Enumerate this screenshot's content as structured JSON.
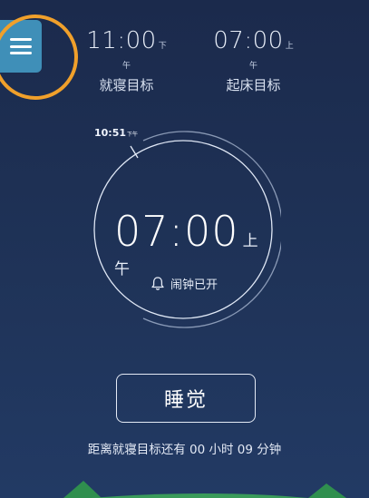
{
  "header": {
    "menu_icon": "hamburger-menu-icon",
    "bedtime": {
      "time": "11:00",
      "ampm": "下午",
      "label": "就寝目标"
    },
    "wake": {
      "time": "07:00",
      "ampm": "上午",
      "label": "起床目标"
    }
  },
  "clock": {
    "current_time": "10:51",
    "current_ampm": "下午",
    "alarm_time": "07:00",
    "alarm_ampm": "上午",
    "alarm_status": "闹钟已开",
    "alarm_icon": "bell-icon"
  },
  "actions": {
    "sleep_label": "睡觉"
  },
  "footer": {
    "remaining_text": "距离就寝目标还有 00 小时 09 分钟"
  },
  "colors": {
    "background_top": "#1b2a4c",
    "background_bottom": "#223a64",
    "menu_button": "#3f8fb8",
    "annotation_circle": "#f0a02b",
    "ground": "#2f8f4e"
  }
}
